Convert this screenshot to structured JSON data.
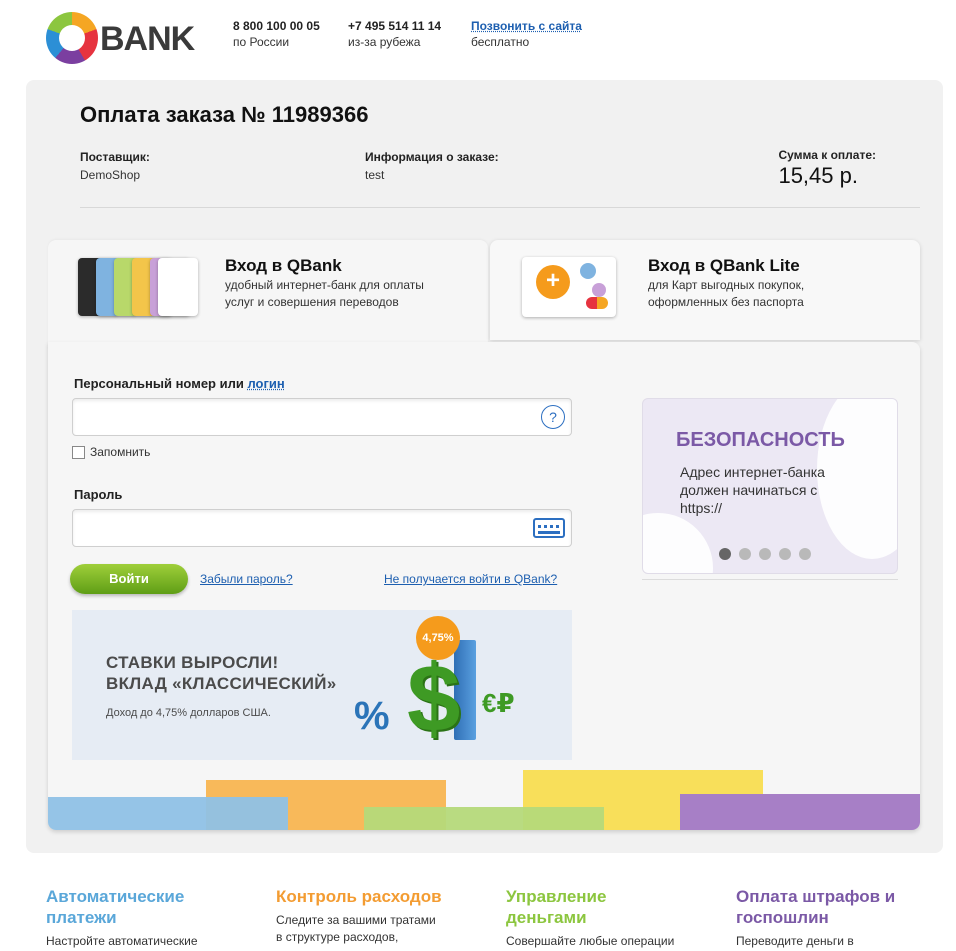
{
  "header": {
    "logo_text": "BANK",
    "phones": [
      {
        "number": "8 800 100 00 05",
        "note": "по России"
      },
      {
        "number": "+7 495 514 11 14",
        "note": "из-за рубежа"
      }
    ],
    "callback": {
      "label": "Позвонить с сайта",
      "note": "бесплатно"
    }
  },
  "order": {
    "title": "Оплата заказа № 11989366",
    "supplier_label": "Поставщик:",
    "supplier_value": "DemoShop",
    "info_label": "Информация о заказе:",
    "info_value": "test",
    "amount_label": "Сумма к оплате:",
    "amount_value": "15,45 р."
  },
  "tabs": [
    {
      "title": "Вход в QBank",
      "desc_line1": "удобный интернет-банк для оплаты",
      "desc_line2": "услуг и совершения переводов"
    },
    {
      "title": "Вход в QBank Lite",
      "desc_line1": "для Карт выгодных покупок,",
      "desc_line2": "оформленных без паспорта"
    }
  ],
  "login": {
    "login_label": "Персональный номер или ",
    "login_link": "логин",
    "login_value": "",
    "help_symbol": "?",
    "remember_label": "Запомнить",
    "password_label": "Пароль",
    "password_value": "",
    "submit_label": "Войти",
    "forgot_link": "Забыли пароль?",
    "cant_login_link": "Не получается войти в QBank?"
  },
  "promo": {
    "headline_line1": "СТАВКИ ВЫРОСЛИ!",
    "headline_line2": "ВКЛАД «КЛАССИЧЕСКИЙ»",
    "subline": "Доход до 4,75% долларов США.",
    "badge": "4,75%",
    "dollar": "$",
    "percent": "%",
    "currency": "€₽"
  },
  "security": {
    "title": "БЕЗОПАСНОСТЬ",
    "text": "Адрес интернет-банка должен начинаться с https://",
    "slides_total": 5,
    "slide_active": 1
  },
  "features": [
    {
      "title": "Автоматические платежи",
      "text": "Настройте автоматические",
      "color": "#5aa7d9"
    },
    {
      "title": "Контроль расходов",
      "text_line1": "Следите за вашими тратами",
      "text_line2": "в структуре расходов,",
      "color": "#f39c32"
    },
    {
      "title": "Управление деньгами",
      "text": "Совершайте любые операции",
      "color": "#8cc63f"
    },
    {
      "title": "Оплата штрафов и госпошлин",
      "text": "Переводите деньги в",
      "color": "#7b59a6"
    }
  ],
  "colors": {
    "accent": "#1d5fb0",
    "button": "#6fae1e",
    "security_title": "#7b59a6"
  }
}
